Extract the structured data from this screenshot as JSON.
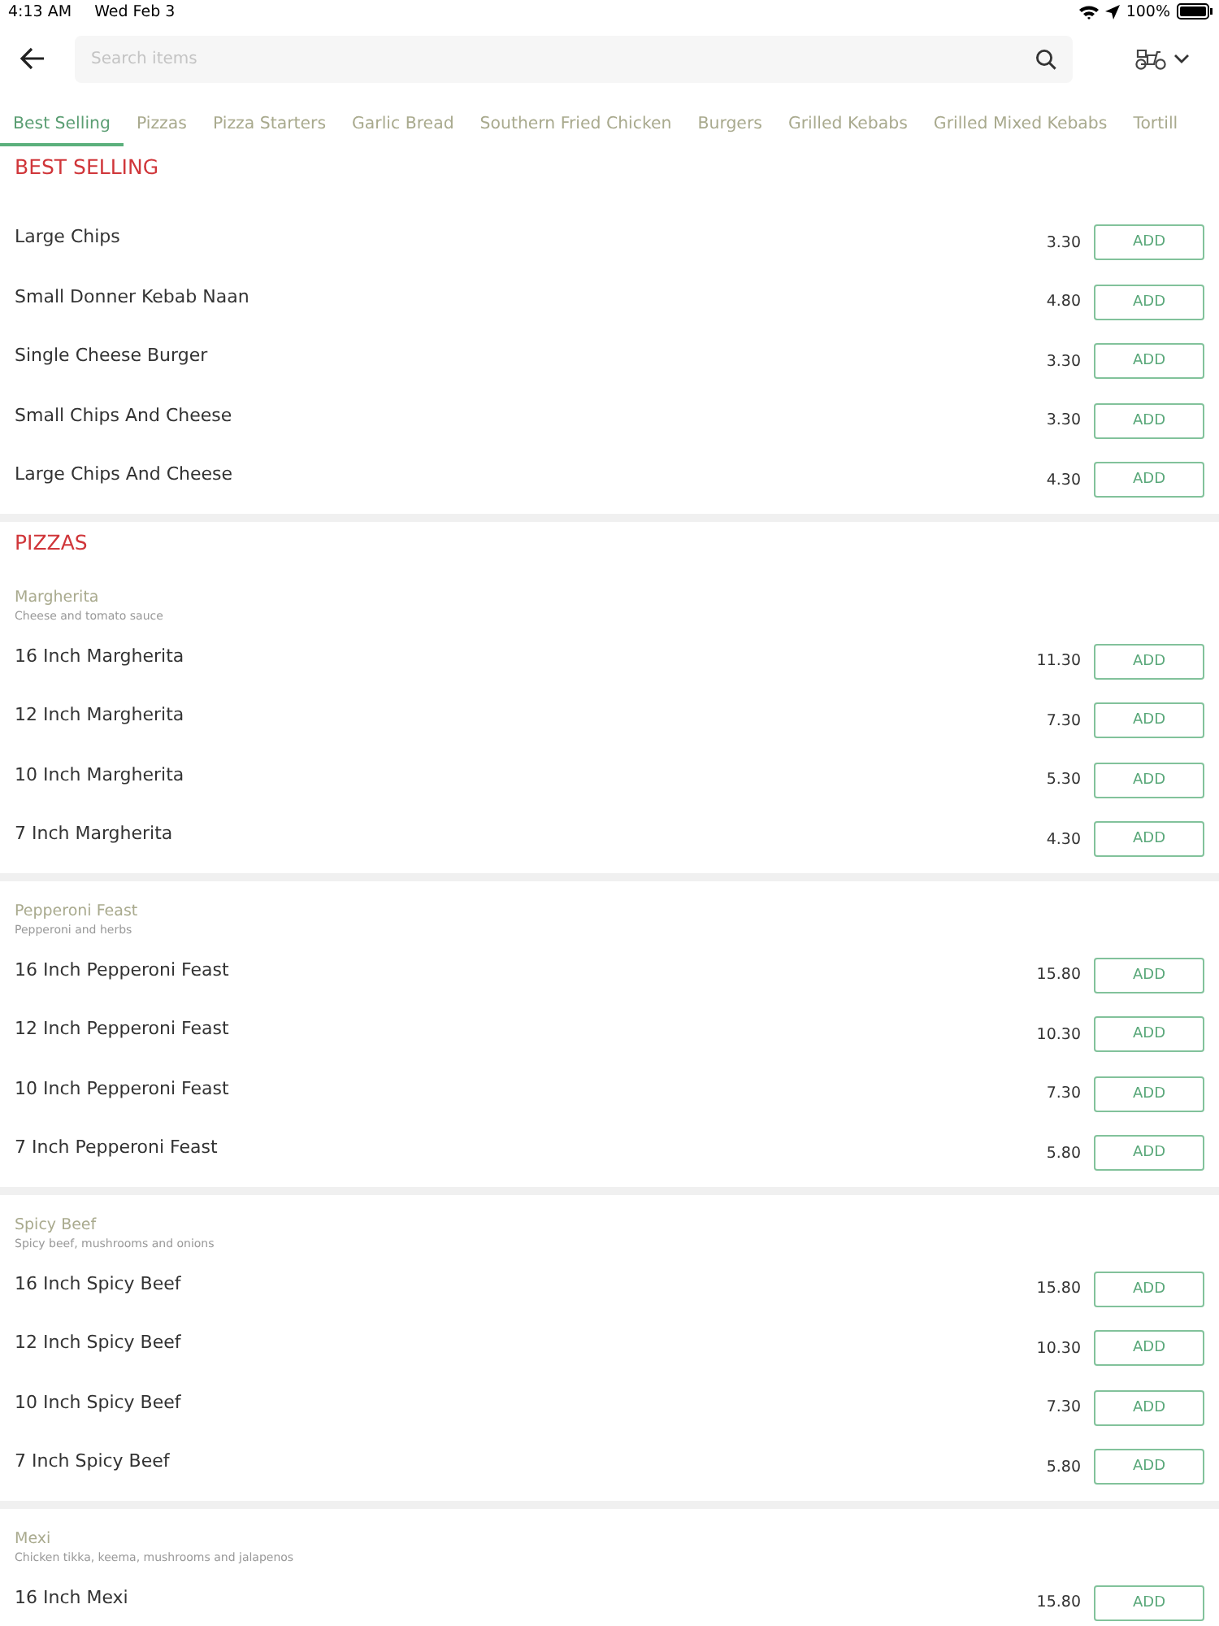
{
  "status_bar": {
    "time": "4:13 AM",
    "date": "Wed Feb 3",
    "battery": "100%"
  },
  "search": {
    "placeholder": "Search items"
  },
  "tabs": [
    {
      "label": "Best Selling",
      "selected": true
    },
    {
      "label": "Pizzas",
      "selected": false
    },
    {
      "label": "Pizza Starters",
      "selected": false
    },
    {
      "label": "Garlic Bread",
      "selected": false
    },
    {
      "label": "Southern Fried Chicken",
      "selected": false
    },
    {
      "label": "Burgers",
      "selected": false
    },
    {
      "label": "Grilled Kebabs",
      "selected": false
    },
    {
      "label": "Grilled Mixed Kebabs",
      "selected": false
    },
    {
      "label": "Tortill",
      "selected": false
    }
  ],
  "sections": [
    {
      "title": "BEST SELLING",
      "groups": [
        {
          "items": [
            {
              "name": "Large Chips",
              "price": "3.30",
              "button": "ADD"
            },
            {
              "name": "Small Donner Kebab Naan",
              "price": "4.80",
              "button": "ADD"
            },
            {
              "name": "Single Cheese Burger",
              "price": "3.30",
              "button": "ADD"
            },
            {
              "name": "Small Chips And Cheese",
              "price": "3.30",
              "button": "ADD"
            },
            {
              "name": "Large Chips And Cheese",
              "price": "4.30",
              "button": "ADD"
            }
          ]
        }
      ]
    },
    {
      "title": "PIZZAS",
      "groups": [
        {
          "name": "Margherita",
          "description": "Cheese and tomato sauce",
          "items": [
            {
              "name": "16 Inch Margherita",
              "price": "11.30",
              "button": "ADD"
            },
            {
              "name": "12 Inch Margherita",
              "price": "7.30",
              "button": "ADD"
            },
            {
              "name": "10 Inch Margherita",
              "price": "5.30",
              "button": "ADD"
            },
            {
              "name": "7 Inch Margherita",
              "price": "4.30",
              "button": "ADD"
            }
          ]
        },
        {
          "name": "Pepperoni Feast",
          "description": "Pepperoni and herbs",
          "items": [
            {
              "name": "16 Inch Pepperoni Feast",
              "price": "15.80",
              "button": "ADD"
            },
            {
              "name": "12 Inch Pepperoni Feast",
              "price": "10.30",
              "button": "ADD"
            },
            {
              "name": "10 Inch Pepperoni Feast",
              "price": "7.30",
              "button": "ADD"
            },
            {
              "name": "7 Inch Pepperoni Feast",
              "price": "5.80",
              "button": "ADD"
            }
          ]
        },
        {
          "name": "Spicy Beef",
          "description": "Spicy beef, mushrooms and onions",
          "items": [
            {
              "name": "16 Inch Spicy Beef",
              "price": "15.80",
              "button": "ADD"
            },
            {
              "name": "12 Inch Spicy Beef",
              "price": "10.30",
              "button": "ADD"
            },
            {
              "name": "10 Inch Spicy Beef",
              "price": "7.30",
              "button": "ADD"
            },
            {
              "name": "7 Inch Spicy Beef",
              "price": "5.80",
              "button": "ADD"
            }
          ]
        },
        {
          "name": "Mexi",
          "description": "Chicken tikka, keema, mushrooms and jalapenos",
          "items": [
            {
              "name": "16 Inch Mexi",
              "price": "15.80",
              "button": "ADD"
            }
          ]
        }
      ]
    }
  ]
}
